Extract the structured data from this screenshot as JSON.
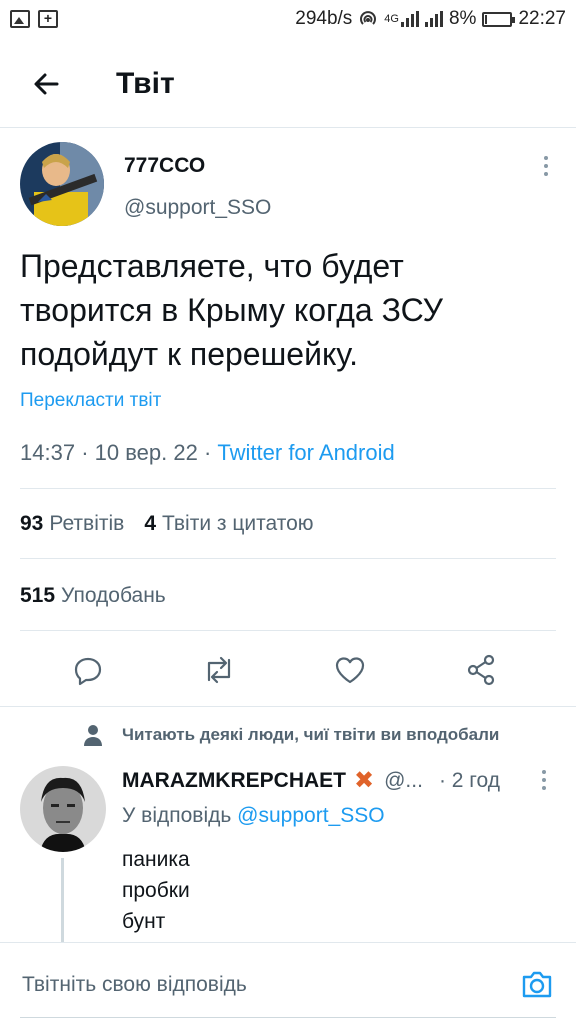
{
  "status_bar": {
    "network_speed": "294b/s",
    "network_type": "4G",
    "battery": "8%",
    "battery_level": 0.08,
    "time": "22:27"
  },
  "header": {
    "title": "Твіт"
  },
  "tweet": {
    "display_name": "777ССО",
    "handle": "@support_SSO",
    "text_lines": [
      "Представляете, что будет",
      "творится в Крыму когда ЗСУ",
      "подойдут к перешейку."
    ],
    "translate_label": "Перекласти твіт",
    "time": "14:37",
    "date": "10 вер. 22",
    "separator": "·",
    "source": "Twitter for Android",
    "retweets_count": "93",
    "retweets_label": "Ретвітів",
    "quotes_count": "4",
    "quotes_label": "Твіти з цитатою",
    "likes_count": "515",
    "likes_label": "Уподобань"
  },
  "social_context": "Читають деякі люди, чиї твіти ви вподобали",
  "reply": {
    "display_name": "MARAZMKREPCHAET",
    "badge": "✖",
    "handle": "@...",
    "time": "· 2 год",
    "reply_to_label": "У відповідь",
    "reply_to_handle": "@support_SSO",
    "lines": [
      "паника",
      "пробки",
      "бунт"
    ]
  },
  "compose": {
    "placeholder": "Твітніть свою відповідь"
  },
  "colors": {
    "accent": "#1d9bf0",
    "text": "#0f1419",
    "muted": "#536471",
    "badge": "#e0632a"
  },
  "icons": [
    "back-arrow-icon",
    "reply-icon",
    "retweet-icon",
    "like-icon",
    "share-icon",
    "camera-icon",
    "person-icon",
    "more-icon"
  ]
}
